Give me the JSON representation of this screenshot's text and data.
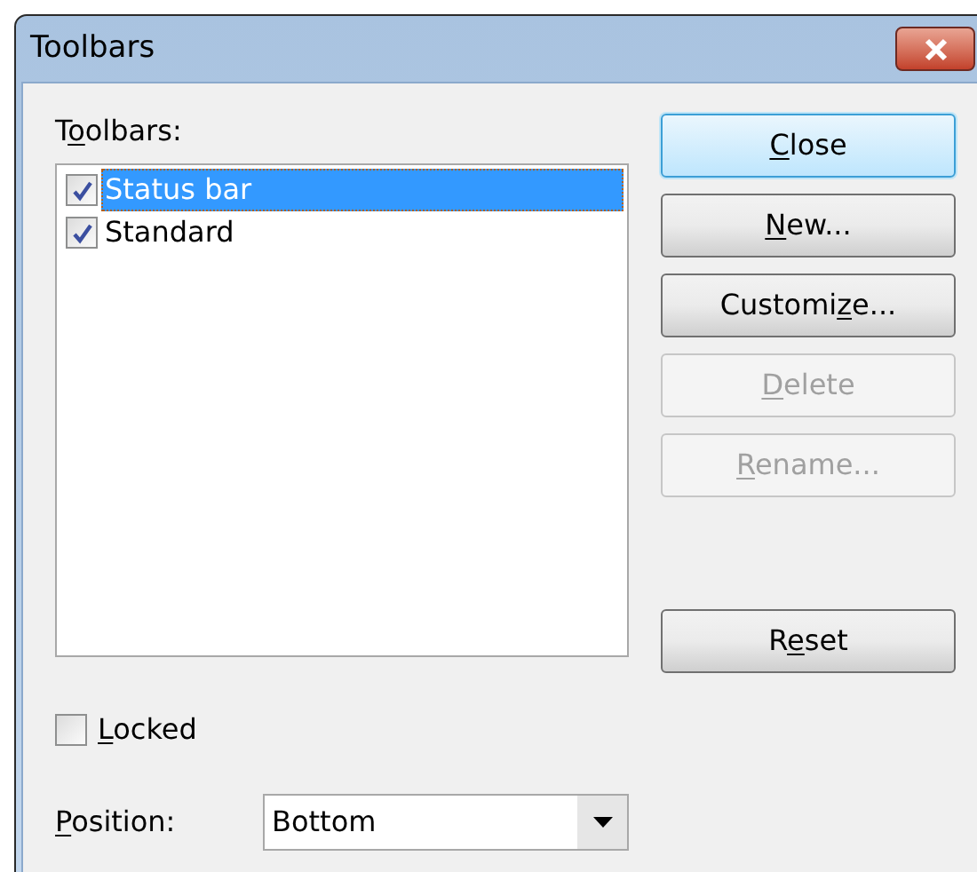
{
  "window": {
    "title": "Toolbars"
  },
  "toolbars_label": {
    "before": "T",
    "key": "o",
    "after": "olbars:"
  },
  "toolbars": [
    {
      "label": "Status bar",
      "checked": true,
      "selected": true
    },
    {
      "label": "Standard",
      "checked": true,
      "selected": false
    }
  ],
  "buttons": [
    {
      "label": {
        "key": "C",
        "after": "lose"
      },
      "disabled": false,
      "default": true
    },
    {
      "label": {
        "key": "N",
        "after": "ew..."
      },
      "disabled": false,
      "default": false
    },
    {
      "label": {
        "before": "Customi",
        "key": "z",
        "after": "e..."
      },
      "disabled": false,
      "default": false
    },
    {
      "label": {
        "key": "D",
        "after": "elete"
      },
      "disabled": true,
      "default": false
    },
    {
      "label": {
        "key": "R",
        "after": "ename..."
      },
      "disabled": true,
      "default": false
    }
  ],
  "reset_button": {
    "label": {
      "before": "R",
      "key": "e",
      "after": "set"
    },
    "disabled": false,
    "default": false
  },
  "locked": {
    "label": {
      "key": "L",
      "after": "ocked"
    },
    "checked": false
  },
  "position": {
    "label": {
      "key": "P",
      "after": "osition:"
    },
    "value": "Bottom"
  }
}
